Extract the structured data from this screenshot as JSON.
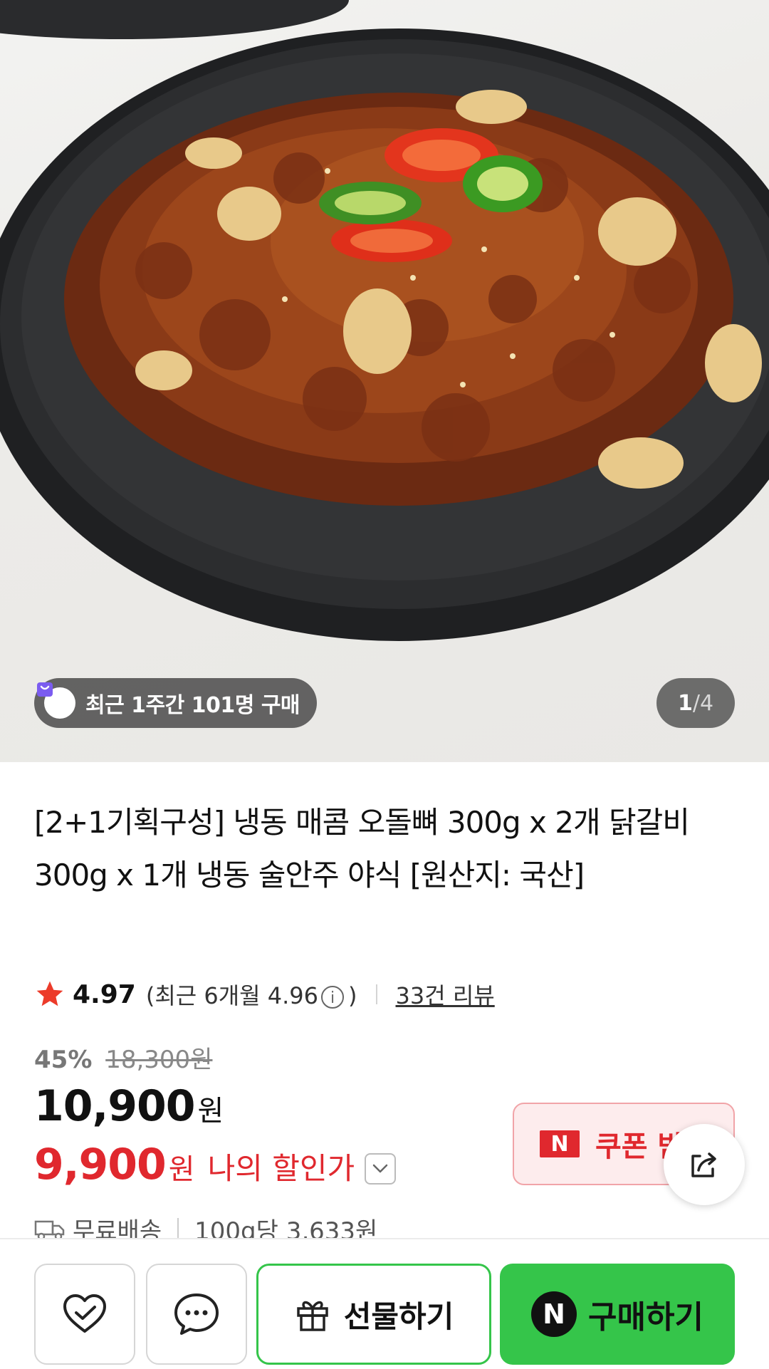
{
  "hero": {
    "image_alt": "",
    "buyers_badge": "최근 1주간 101명 구매",
    "page_current": "1",
    "page_separator": "/",
    "page_total": "4"
  },
  "product": {
    "title": "[2+1기획구성] 냉동 매콤 오돌뼈 300g x 2개 닭갈비 300g x 1개 냉동 술안주 야식 [원산지: 국산]",
    "rating": "4.97",
    "recent_rating_prefix": "(최근 6개월 4.96",
    "recent_rating_suffix": ")",
    "reviews": "33건 리뷰",
    "discount_pct": "45%",
    "original_price": "18,300원",
    "price": "10,900",
    "price_unit": "원",
    "my_price": "9,900",
    "my_price_unit": "원",
    "my_price_label": "나의 할인가",
    "coupon_badge": "N",
    "coupon_label": "쿠폰 받",
    "shipping": "무료배송",
    "unit_price": "100g당 3,633원"
  },
  "bottom_bar": {
    "gift_label": "선물하기",
    "buy_badge": "N",
    "buy_label": "구매하기"
  },
  "colors": {
    "accent_green": "#35c54a",
    "sale_red": "#e0282e"
  }
}
